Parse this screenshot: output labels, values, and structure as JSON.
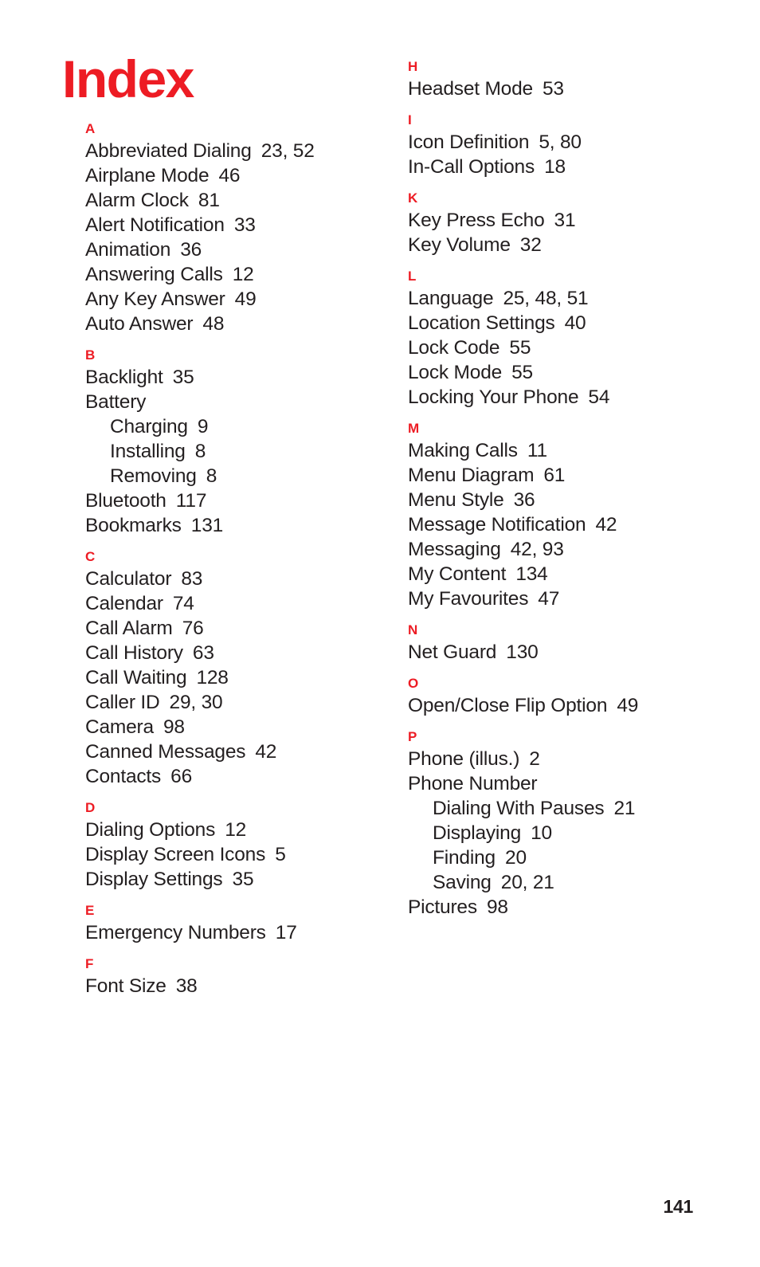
{
  "document": {
    "title": "Index",
    "page_number": "141",
    "accent_color": "#ED1C24",
    "text_color": "#231F20"
  },
  "columns": [
    {
      "name": "left",
      "sections": [
        {
          "letter": "A",
          "entries": [
            {
              "term": "Abbreviated Dialing",
              "pages": "23, 52",
              "level": 0
            },
            {
              "term": "Airplane Mode",
              "pages": "46",
              "level": 0
            },
            {
              "term": "Alarm Clock",
              "pages": "81",
              "level": 0
            },
            {
              "term": "Alert Notification",
              "pages": "33",
              "level": 0
            },
            {
              "term": "Animation",
              "pages": "36",
              "level": 0
            },
            {
              "term": "Answering Calls",
              "pages": "12",
              "level": 0
            },
            {
              "term": "Any Key Answer",
              "pages": "49",
              "level": 0
            },
            {
              "term": "Auto Answer",
              "pages": "48",
              "level": 0
            }
          ]
        },
        {
          "letter": "B",
          "entries": [
            {
              "term": "Backlight",
              "pages": "35",
              "level": 0
            },
            {
              "term": "Battery",
              "pages": "",
              "level": 0
            },
            {
              "term": "Charging",
              "pages": "9",
              "level": 1
            },
            {
              "term": "Installing",
              "pages": "8",
              "level": 1
            },
            {
              "term": "Removing",
              "pages": "8",
              "level": 1
            },
            {
              "term": "Bluetooth",
              "pages": "117",
              "level": 0
            },
            {
              "term": "Bookmarks",
              "pages": "131",
              "level": 0
            }
          ]
        },
        {
          "letter": "C",
          "entries": [
            {
              "term": "Calculator",
              "pages": "83",
              "level": 0
            },
            {
              "term": "Calendar",
              "pages": "74",
              "level": 0
            },
            {
              "term": "Call Alarm",
              "pages": "76",
              "level": 0
            },
            {
              "term": "Call History",
              "pages": "63",
              "level": 0
            },
            {
              "term": "Call Waiting",
              "pages": "128",
              "level": 0
            },
            {
              "term": "Caller ID",
              "pages": "29, 30",
              "level": 0
            },
            {
              "term": "Camera",
              "pages": "98",
              "level": 0
            },
            {
              "term": "Canned Messages",
              "pages": "42",
              "level": 0
            },
            {
              "term": "Contacts",
              "pages": "66",
              "level": 0
            }
          ]
        },
        {
          "letter": "D",
          "entries": [
            {
              "term": "Dialing Options",
              "pages": "12",
              "level": 0
            },
            {
              "term": "Display Screen Icons",
              "pages": "5",
              "level": 0
            },
            {
              "term": "Display Settings",
              "pages": "35",
              "level": 0
            }
          ]
        },
        {
          "letter": "E",
          "entries": [
            {
              "term": "Emergency Numbers",
              "pages": "17",
              "level": 0
            }
          ]
        },
        {
          "letter": "F",
          "entries": [
            {
              "term": "Font Size",
              "pages": "38",
              "level": 0
            }
          ]
        }
      ]
    },
    {
      "name": "right",
      "sections": [
        {
          "letter": "H",
          "entries": [
            {
              "term": "Headset Mode",
              "pages": "53",
              "level": 0
            }
          ]
        },
        {
          "letter": "I",
          "entries": [
            {
              "term": "Icon Definition",
              "pages": "5, 80",
              "level": 0
            },
            {
              "term": "In-Call Options",
              "pages": "18",
              "level": 0
            }
          ]
        },
        {
          "letter": "K",
          "entries": [
            {
              "term": "Key Press Echo",
              "pages": "31",
              "level": 0
            },
            {
              "term": "Key Volume",
              "pages": "32",
              "level": 0
            }
          ]
        },
        {
          "letter": "L",
          "entries": [
            {
              "term": "Language",
              "pages": "25, 48, 51",
              "level": 0
            },
            {
              "term": "Location Settings",
              "pages": "40",
              "level": 0
            },
            {
              "term": "Lock Code",
              "pages": "55",
              "level": 0
            },
            {
              "term": "Lock Mode",
              "pages": "55",
              "level": 0
            },
            {
              "term": "Locking Your Phone",
              "pages": "54",
              "level": 0
            }
          ]
        },
        {
          "letter": "M",
          "entries": [
            {
              "term": "Making Calls",
              "pages": "11",
              "level": 0
            },
            {
              "term": "Menu Diagram",
              "pages": "61",
              "level": 0
            },
            {
              "term": "Menu Style",
              "pages": "36",
              "level": 0
            },
            {
              "term": "Message Notification",
              "pages": "42",
              "level": 0
            },
            {
              "term": "Messaging",
              "pages": "42, 93",
              "level": 0
            },
            {
              "term": "My Content",
              "pages": "134",
              "level": 0
            },
            {
              "term": "My Favourites",
              "pages": "47",
              "level": 0
            }
          ]
        },
        {
          "letter": "N",
          "entries": [
            {
              "term": "Net Guard",
              "pages": "130",
              "level": 0
            }
          ]
        },
        {
          "letter": "O",
          "entries": [
            {
              "term": "Open/Close Flip Option",
              "pages": "49",
              "level": 0
            }
          ]
        },
        {
          "letter": "P",
          "entries": [
            {
              "term": "Phone (illus.)",
              "pages": "2",
              "level": 0
            },
            {
              "term": "Phone Number",
              "pages": "",
              "level": 0
            },
            {
              "term": "Dialing With Pauses",
              "pages": "21",
              "level": 1
            },
            {
              "term": "Displaying",
              "pages": "10",
              "level": 1
            },
            {
              "term": "Finding",
              "pages": "20",
              "level": 1
            },
            {
              "term": "Saving",
              "pages": "20, 21",
              "level": 1
            },
            {
              "term": "Pictures",
              "pages": "98",
              "level": 0
            }
          ]
        }
      ]
    }
  ]
}
